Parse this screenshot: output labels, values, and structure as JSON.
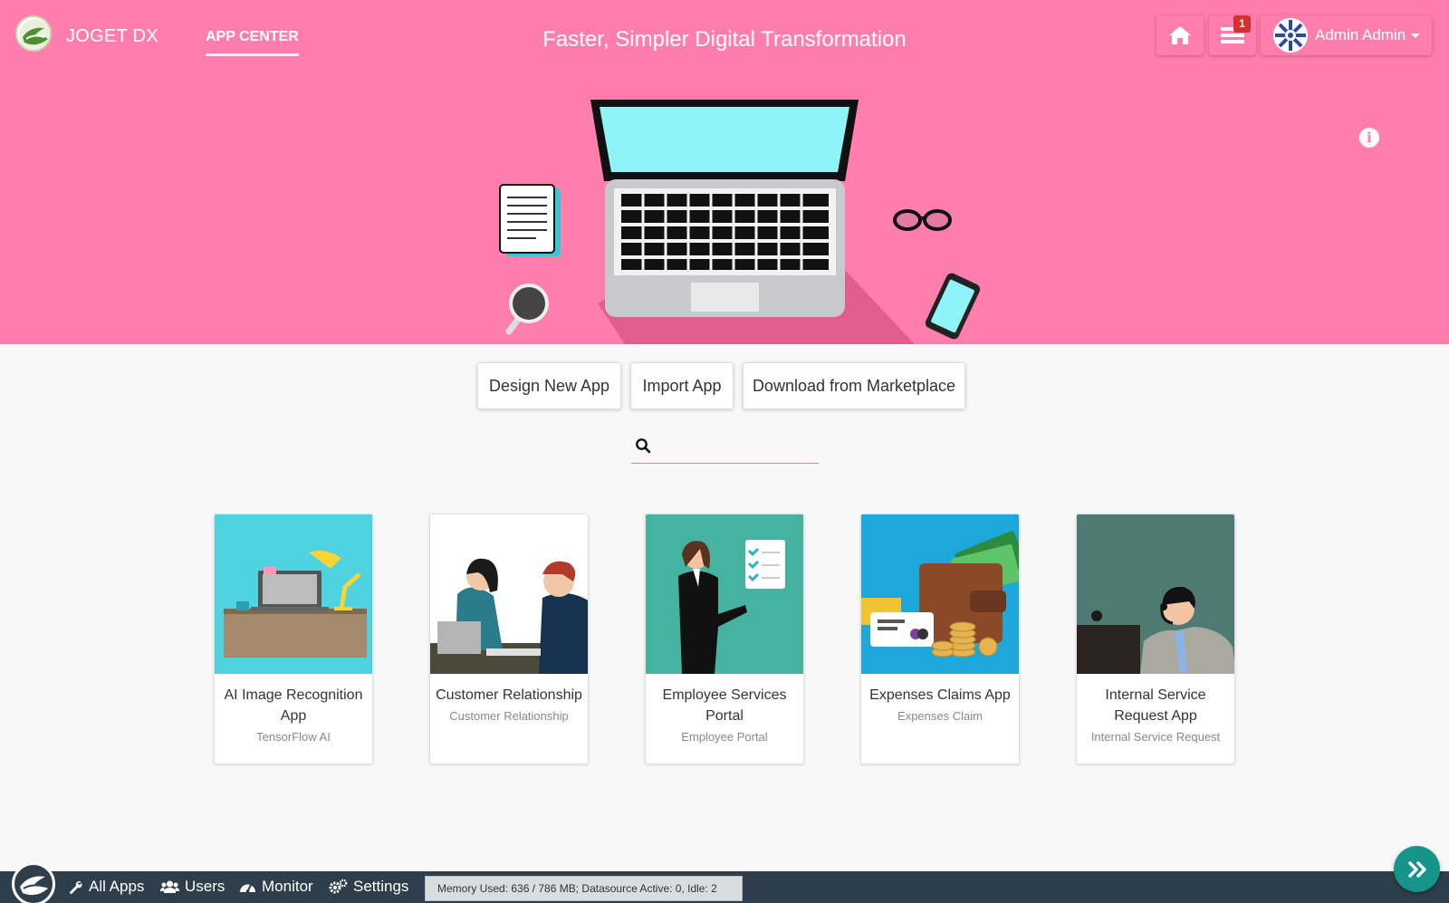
{
  "header": {
    "brand": "JOGET DX",
    "nav_app_center": "APP CENTER",
    "tagline": "Faster, Simpler Digital Transformation",
    "notification_count": "1",
    "user_name": "Admin Admin"
  },
  "actions": {
    "design_new_app": "Design New App",
    "import_app": "Import App",
    "download_marketplace": "Download from Marketplace"
  },
  "search": {
    "placeholder": "",
    "value": ""
  },
  "apps": [
    {
      "title": "AI Image Recognition App",
      "subtitle": "TensorFlow AI"
    },
    {
      "title": "Customer Relationship",
      "subtitle": "Customer Relationship"
    },
    {
      "title": "Employee Services Portal",
      "subtitle": "Employee Portal"
    },
    {
      "title": "Expenses Claims App",
      "subtitle": "Expenses Claim"
    },
    {
      "title": "Internal Service Request App",
      "subtitle": "Internal Service Request"
    }
  ],
  "bottom_bar": {
    "all_apps": "All Apps",
    "users": "Users",
    "monitor": "Monitor",
    "settings": "Settings",
    "status": "Memory Used: 636 / 786 MB; Datasource Active: 0, Idle: 2"
  },
  "colors": {
    "hero_pink": "#ff7eab",
    "bottom_bar": "#2e3e4a",
    "fab_teal": "#179489",
    "badge_red": "#d3302f"
  }
}
